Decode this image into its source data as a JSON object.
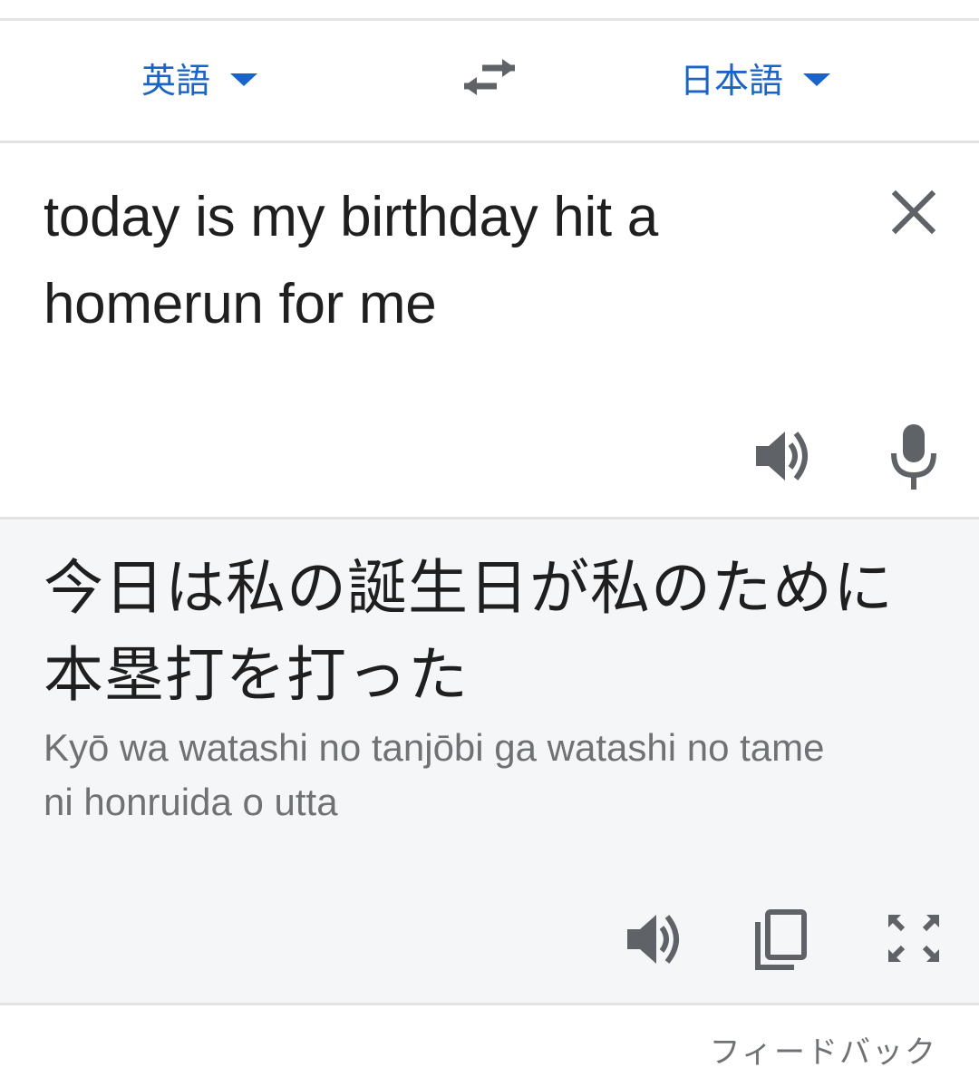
{
  "language_bar": {
    "source_language": "英語",
    "target_language": "日本語",
    "swap_icon": "swap-arrows-icon",
    "accent_color": "#1a63c7"
  },
  "source": {
    "text": "today is my birthday hit a homerun for me",
    "icons": [
      "close-icon",
      "speaker-icon",
      "microphone-icon"
    ]
  },
  "result": {
    "translation": "今日は私の誕生日が私のために本塁打を打った",
    "romanization": "Kyō wa watashi no tanjōbi ga watashi no tame ni honruida o utta",
    "icons": [
      "speaker-icon",
      "copy-icon",
      "fullscreen-icon"
    ]
  },
  "footer": {
    "feedback_label": "フィードバック"
  }
}
